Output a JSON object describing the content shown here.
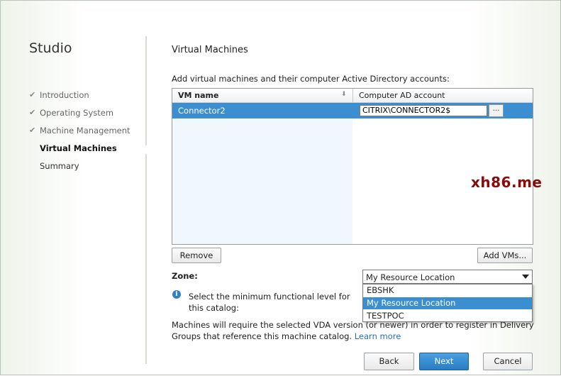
{
  "sidebar": {
    "title": "Studio",
    "steps": [
      {
        "label": "Introduction",
        "state": "done"
      },
      {
        "label": "Operating System",
        "state": "done"
      },
      {
        "label": "Machine Management",
        "state": "done"
      },
      {
        "label": "Virtual Machines",
        "state": "current"
      },
      {
        "label": "Summary",
        "state": "pending"
      }
    ]
  },
  "main": {
    "title": "Virtual Machines",
    "instruction": "Add virtual machines and their computer Active Directory accounts:",
    "table": {
      "columns": [
        "VM name",
        "Computer AD account"
      ],
      "rows": [
        {
          "vm_name": "Connector2",
          "ad_account": "CITRIX\\CONNECTOR2$",
          "selected": true
        }
      ],
      "browse_label": "..."
    },
    "remove_label": "Remove",
    "add_vms_label": "Add VMs...",
    "zone": {
      "label": "Zone:",
      "selected": "My Resource Location",
      "options": [
        "EBSHK",
        "My Resource Location",
        "TESTPOC"
      ]
    },
    "info_text": "Select the minimum functional level for this catalog:",
    "paragraph": "Machines will require the selected VDA version (or newer) in order to register in Delivery Groups that reference this machine catalog.",
    "learn_more": "Learn more"
  },
  "footer": {
    "back_label": "Back",
    "next_label": "Next",
    "cancel_label": "Cancel"
  },
  "watermark": "xh86.me",
  "colors": {
    "selection": "#3b8fd1",
    "primary_button": "#2a7dc3",
    "link": "#2a6fb8",
    "watermark": "#8b0b0b"
  }
}
